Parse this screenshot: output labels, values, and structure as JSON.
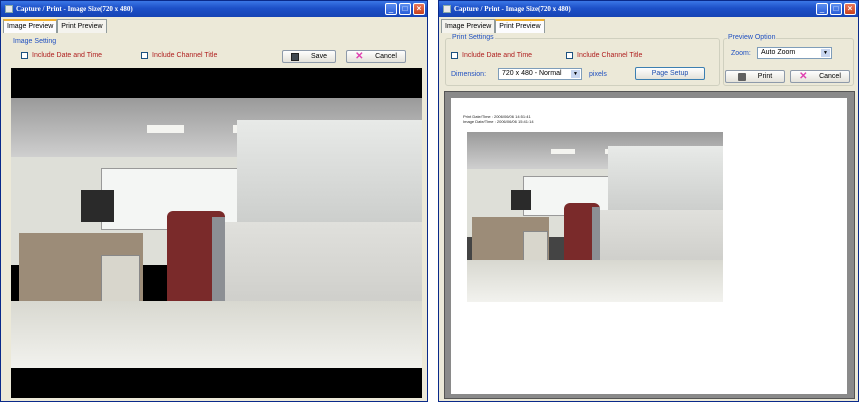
{
  "left_window": {
    "title": "Capture / Print - Image Size(720 x 480)",
    "tabs": [
      {
        "label": "Image Preview",
        "active": true
      },
      {
        "label": "Print Preview",
        "active": false
      }
    ],
    "section_label": "Image Setting",
    "checkbox_date_time": "Include Date and Time",
    "checkbox_channel_title": "Include Channel Title",
    "save_label": "Save",
    "cancel_label": "Cancel"
  },
  "right_window": {
    "title": "Capture / Print - Image Size(720 x 480)",
    "tabs": [
      {
        "label": "Image Preview",
        "active": false
      },
      {
        "label": "Print Preview",
        "active": true
      }
    ],
    "print_settings_label": "Print Settings",
    "checkbox_date_time": "Include Date and Time",
    "checkbox_channel_title": "Include Channel Title",
    "dimension_label": "Dimension:",
    "dimension_value": "720 x 480 - Normal",
    "dimension_unit": "pixels",
    "page_setup_label": "Page Setup",
    "preview_option_label": "Preview Option",
    "zoom_label": "Zoom:",
    "zoom_value": "Auto Zoom",
    "print_label": "Print",
    "cancel_label": "Cancel",
    "print_stamp_line1": "Print Date/Time : 2006/06/06 14:51:41",
    "print_stamp_line2": "Image Date/Time : 2006/06/06 15:41:14"
  },
  "icons": {
    "save": "disk-icon",
    "cancel": "x-icon",
    "print": "printer-icon",
    "minimize": "minimize-icon",
    "maximize": "maximize-icon",
    "close": "close-icon"
  },
  "colors": {
    "titlebar": "#1d50c8",
    "dialog_bg": "#ece9d8",
    "label_blue": "#2050c0",
    "checkbox_text_red": "#b02020"
  }
}
